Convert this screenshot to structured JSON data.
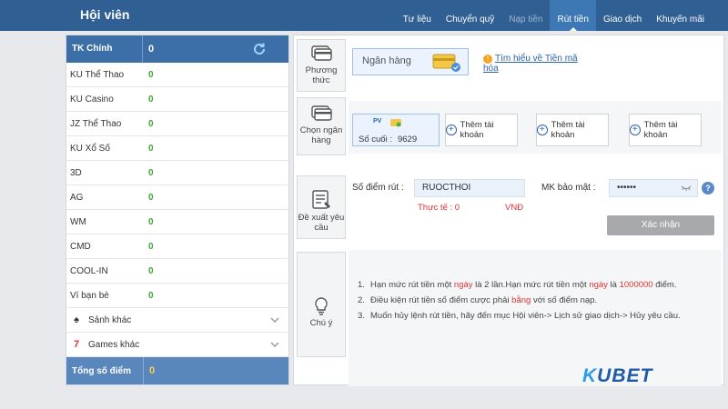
{
  "header": {
    "title": "Hội viên",
    "tabs": [
      {
        "label": "Tư liệu",
        "state": "normal"
      },
      {
        "label": "Chuyển quỹ",
        "state": "normal"
      },
      {
        "label": "Nạp tiền",
        "state": "disabled"
      },
      {
        "label": "Rút tiền",
        "state": "active"
      },
      {
        "label": "Giao dịch",
        "state": "normal"
      },
      {
        "label": "Khuyến mãi",
        "state": "normal"
      }
    ]
  },
  "accounts": {
    "main": {
      "name": "TK Chính",
      "value": "0"
    },
    "items": [
      {
        "name": "KU Thể Thao",
        "value": "0"
      },
      {
        "name": "KU Casino",
        "value": "0"
      },
      {
        "name": "JZ Thể Thao",
        "value": "0"
      },
      {
        "name": "KU Xổ Số",
        "value": "0"
      },
      {
        "name": "3D",
        "value": "0"
      },
      {
        "name": "AG",
        "value": "0"
      },
      {
        "name": "WM",
        "value": "0"
      },
      {
        "name": "CMD",
        "value": "0"
      },
      {
        "name": "COOL-IN",
        "value": "0"
      },
      {
        "name": "Ví bạn bè",
        "value": "0"
      }
    ],
    "groups": [
      {
        "name": "Sảnh khác",
        "icon": "spade-icon"
      },
      {
        "name": "Games khác",
        "icon": "seven-icon"
      }
    ],
    "total": {
      "name": "Tổng số điểm",
      "value": "0"
    }
  },
  "method": {
    "button": "Phương thức",
    "selected": "Ngân hàng",
    "learn_more": "Tìm hiểu về Tiền mã hóa"
  },
  "bank": {
    "button": "Chọn ngân hàng",
    "card_brand": "PV",
    "last_digits_label": "Số cuối :",
    "last_digits": "9629",
    "add_label": "Thêm tài khoản"
  },
  "request": {
    "button": "Đề xuất yêu cầu",
    "points_label": "Số điểm rút :",
    "points_value": "RUOCTHOI",
    "actual_label": "Thực tế :",
    "actual_value": "0",
    "currency": "VNĐ",
    "password_label": "MK bảo mật :",
    "password_value": "••••••",
    "confirm": "Xác nhận"
  },
  "notes": {
    "button": "Chú ý",
    "n1": "1.",
    "l1a": "Hạn mức rút tiền một ",
    "l1b": "ngày",
    "l1c": " là 2 lần.Hạn mức rút tiền một ",
    "l1d": "ngày",
    "l1e": " là ",
    "l1f": "1000000",
    "l1g": " điểm.",
    "n2": "2.",
    "l2a": "Điều kiện rút tiền số điểm cược phải ",
    "l2b": "bằng",
    "l2c": " với số điểm nạp.",
    "n3": "3.",
    "l3": "Muốn hủy lệnh rút tiền, hãy đến mục Hội viên-> Lịch sử giao dịch-> Hủy yêu cầu."
  },
  "brand": {
    "k": "K",
    "rest": "UBET"
  }
}
